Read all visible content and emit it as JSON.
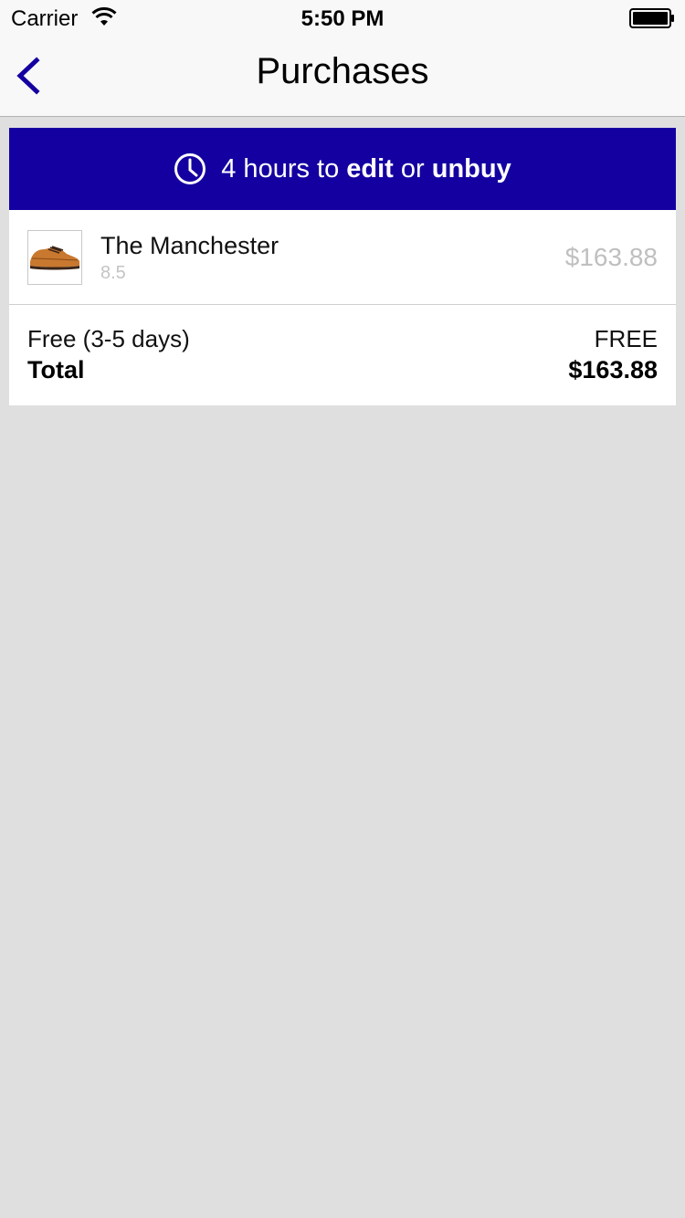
{
  "status_bar": {
    "carrier": "Carrier",
    "time": "5:50 PM"
  },
  "nav": {
    "title": "Purchases",
    "back_icon": "chevron-left-icon"
  },
  "colors": {
    "accent": "#1400a0",
    "background": "#dfdfdf"
  },
  "banner": {
    "icon": "clock-icon",
    "prefix": "4 hours to ",
    "edit": "edit",
    "middle": " or ",
    "unbuy": "unbuy"
  },
  "items": [
    {
      "name": "The Manchester",
      "size": "8.5",
      "price": "$163.88",
      "thumbnail": "brown-shoe"
    }
  ],
  "summary": {
    "shipping_label": "Free (3-5 days)",
    "shipping_value": "FREE",
    "total_label": "Total",
    "total_value": "$163.88"
  }
}
